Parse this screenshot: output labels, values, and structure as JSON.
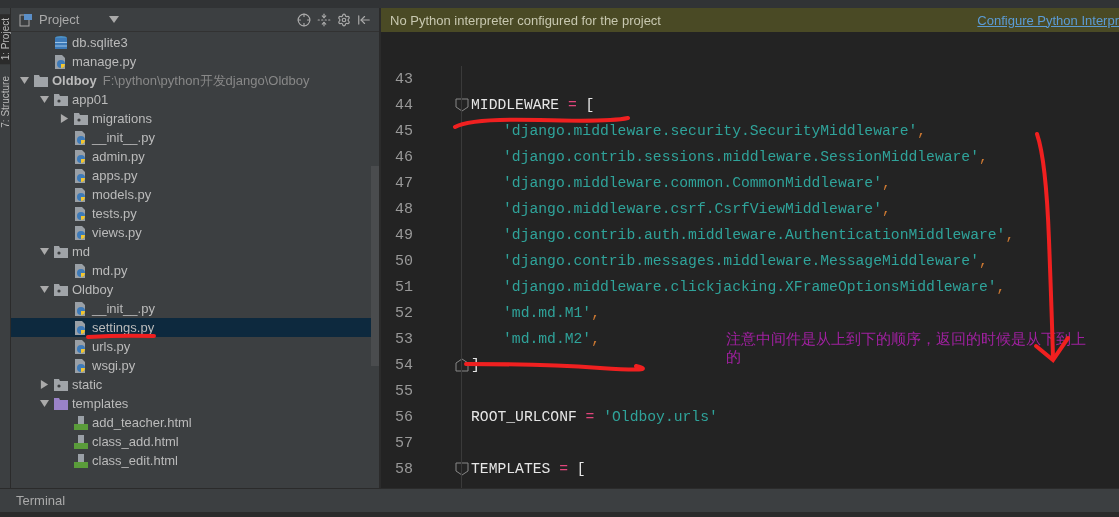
{
  "tool_strip": {
    "tabs": [
      {
        "label": "1: Project",
        "selected": true
      },
      {
        "label": "7: Structure",
        "selected": false
      }
    ]
  },
  "project_panel": {
    "title": "Project",
    "tree": [
      {
        "kind": "continued",
        "children": [
          {
            "kind": "database",
            "name": "db.sqlite3",
            "selected": false
          },
          {
            "kind": "python",
            "name": "manage.py",
            "selected": false
          }
        ]
      },
      {
        "kind": "root",
        "name": "Oldboy",
        "hint": "F:\\python\\python开发django\\Oldboy",
        "expanded": true,
        "selected": false,
        "children": [
          {
            "kind": "package",
            "name": "app01",
            "expanded": true,
            "selected": false,
            "children": [
              {
                "kind": "package",
                "name": "migrations",
                "expanded": false,
                "selected": false
              },
              {
                "kind": "python",
                "name": "__init__.py",
                "selected": false
              },
              {
                "kind": "python",
                "name": "admin.py",
                "selected": false
              },
              {
                "kind": "python",
                "name": "apps.py",
                "selected": false
              },
              {
                "kind": "python",
                "name": "models.py",
                "selected": false
              },
              {
                "kind": "python",
                "name": "tests.py",
                "selected": false
              },
              {
                "kind": "python",
                "name": "views.py",
                "selected": false
              }
            ]
          },
          {
            "kind": "package",
            "name": "md",
            "expanded": true,
            "selected": false,
            "children": [
              {
                "kind": "python",
                "name": "md.py",
                "selected": false
              }
            ]
          },
          {
            "kind": "package",
            "name": "Oldboy",
            "expanded": true,
            "selected": false,
            "children": [
              {
                "kind": "python",
                "name": "__init__.py",
                "selected": false
              },
              {
                "kind": "python",
                "name": "settings.py",
                "selected": true
              },
              {
                "kind": "python",
                "name": "urls.py",
                "selected": false
              },
              {
                "kind": "python",
                "name": "wsgi.py",
                "selected": false
              }
            ]
          },
          {
            "kind": "package",
            "name": "static",
            "expanded": false,
            "selected": false
          },
          {
            "kind": "template-folder",
            "name": "templates",
            "expanded": true,
            "selected": false,
            "children": [
              {
                "kind": "html",
                "name": "add_teacher.html",
                "selected": false
              },
              {
                "kind": "html",
                "name": "class_add.html",
                "selected": false
              },
              {
                "kind": "html",
                "name": "class_edit.html",
                "selected": false
              }
            ]
          }
        ]
      }
    ]
  },
  "notification": {
    "message": "No Python interpreter configured for the project",
    "link": "Configure Python Interpr"
  },
  "editor": {
    "lines": [
      {
        "number": "43"
      },
      {
        "number": "44",
        "fold_start": true,
        "tokens": [
          {
            "kind": "name",
            "text": "MIDDLEWARE"
          },
          {
            "kind": "op",
            "text": " = "
          },
          {
            "kind": "name",
            "text": "["
          }
        ]
      },
      {
        "number": "45",
        "indented": true,
        "tokens": [
          {
            "kind": "string",
            "text": "'django.middleware.security.SecurityMiddleware'"
          },
          {
            "kind": "comma",
            "text": ","
          }
        ]
      },
      {
        "number": "46",
        "indented": true,
        "tokens": [
          {
            "kind": "string",
            "text": "'django.contrib.sessions.middleware.SessionMiddleware'"
          },
          {
            "kind": "comma",
            "text": ","
          }
        ]
      },
      {
        "number": "47",
        "indented": true,
        "tokens": [
          {
            "kind": "string",
            "text": "'django.middleware.common.CommonMiddleware'"
          },
          {
            "kind": "comma",
            "text": ","
          }
        ]
      },
      {
        "number": "48",
        "indented": true,
        "tokens": [
          {
            "kind": "string",
            "text": "'django.middleware.csrf.CsrfViewMiddleware'"
          },
          {
            "kind": "comma",
            "text": ","
          }
        ]
      },
      {
        "number": "49",
        "indented": true,
        "tokens": [
          {
            "kind": "string",
            "text": "'django.contrib.auth.middleware.AuthenticationMiddleware'"
          },
          {
            "kind": "comma",
            "text": ","
          }
        ]
      },
      {
        "number": "50",
        "indented": true,
        "tokens": [
          {
            "kind": "string",
            "text": "'django.contrib.messages.middleware.MessageMiddleware'"
          },
          {
            "kind": "comma",
            "text": ","
          }
        ]
      },
      {
        "number": "51",
        "indented": true,
        "tokens": [
          {
            "kind": "string",
            "text": "'django.middleware.clickjacking.XFrameOptionsMiddleware'"
          },
          {
            "kind": "comma",
            "text": ","
          }
        ]
      },
      {
        "number": "52",
        "indented": true,
        "tokens": [
          {
            "kind": "string",
            "text": "'md.md.M1'"
          },
          {
            "kind": "comma",
            "text": ","
          }
        ]
      },
      {
        "number": "53",
        "indented": true,
        "tokens": [
          {
            "kind": "string",
            "text": "'md.md.M2'"
          },
          {
            "kind": "comma",
            "text": ","
          }
        ]
      },
      {
        "number": "54",
        "fold_end": true,
        "tokens": [
          {
            "kind": "name",
            "text": "]"
          }
        ]
      },
      {
        "number": "55"
      },
      {
        "number": "56",
        "tokens": [
          {
            "kind": "name",
            "text": "ROOT_URLCONF"
          },
          {
            "kind": "op",
            "text": " = "
          },
          {
            "kind": "string",
            "text": "'Oldboy.urls'"
          }
        ]
      },
      {
        "number": "57"
      },
      {
        "number": "58",
        "fold_start": true,
        "tokens": [
          {
            "kind": "name",
            "text": "TEMPLATES"
          },
          {
            "kind": "op",
            "text": " = "
          },
          {
            "kind": "name",
            "text": "["
          }
        ]
      }
    ]
  },
  "annotation": {
    "text": "注意中间件是从上到下的顺序，返回的时候是从下到上的"
  },
  "bottom_bar": {
    "tabs": [
      {
        "label": "Terminal"
      }
    ]
  }
}
